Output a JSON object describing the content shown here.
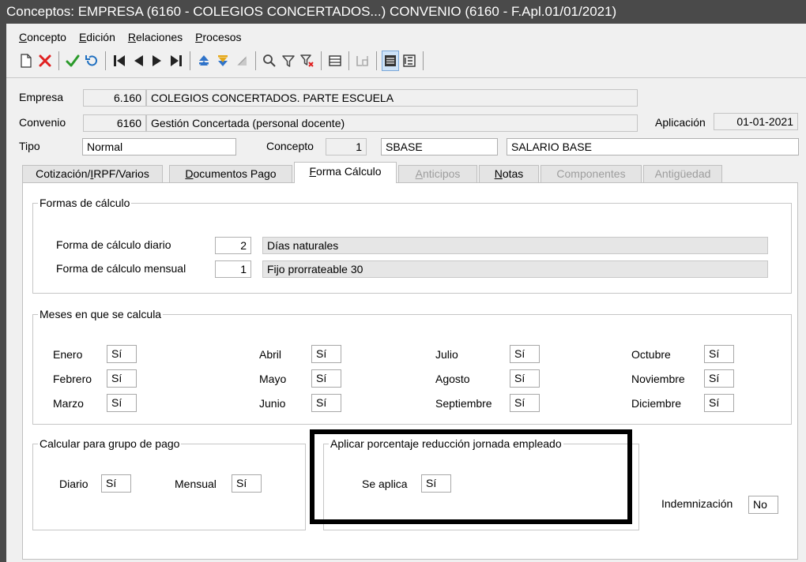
{
  "window": {
    "title": "Conceptos: EMPRESA (6160 - COLEGIOS CONCERTADOS...)  CONVENIO (6160 - F.Apl.01/01/2021)"
  },
  "menu": [
    {
      "key": "C",
      "rest": "oncepto"
    },
    {
      "key": "E",
      "rest": "dición"
    },
    {
      "key": "R",
      "rest": "elaciones"
    },
    {
      "key": "P",
      "rest": "rocesos"
    }
  ],
  "toolbar": {
    "new": "new-document-icon",
    "delete": "delete-x-icon",
    "confirm": "checkmark-icon",
    "undo": "undo-icon",
    "first": "first-record-icon",
    "prev": "previous-record-icon",
    "next": "next-record-icon",
    "last": "last-record-icon",
    "colors": {
      "delete": "#e02020",
      "confirm": "#2a9a2a",
      "undo": "#1e6fc0",
      "nav": "#222222",
      "sortUp": "#2f73c9",
      "sortDown": "#e6a817"
    }
  },
  "header": {
    "empresa_label": "Empresa",
    "empresa_code": "6.160",
    "empresa_name": "COLEGIOS CONCERTADOS. PARTE ESCUELA",
    "convenio_label": "Convenio",
    "convenio_code": "6160",
    "convenio_name": "Gestión Concertada (personal docente)",
    "aplicacion_label": "Aplicación",
    "aplicacion_value": "01-01-2021",
    "tipo_label": "Tipo",
    "tipo_value": "Normal",
    "concepto_label": "Concepto",
    "concepto_num": "1",
    "concepto_code": "SBASE",
    "concepto_desc": "SALARIO BASE"
  },
  "tabs": [
    {
      "pre": "Cotización/",
      "key": "I",
      "post": "RPF/Varios",
      "state": "normal"
    },
    {
      "pre": "",
      "key": "D",
      "post": "ocumentos Pago",
      "state": "normal"
    },
    {
      "pre": "",
      "key": "F",
      "post": "orma Cálculo",
      "state": "active"
    },
    {
      "pre": "",
      "key": "A",
      "post": "nticipos",
      "state": "disabled"
    },
    {
      "pre": "",
      "key": "N",
      "post": "otas",
      "state": "normal"
    },
    {
      "pre": "",
      "key": "",
      "post": "Componentes",
      "state": "disabled"
    },
    {
      "pre": "",
      "key": "",
      "post": "Antigüedad",
      "state": "disabled"
    }
  ],
  "formas": {
    "title": "Formas de cálculo",
    "diario_label": "Forma de cálculo diario",
    "diario_value": "2",
    "diario_desc": "Días naturales",
    "mensual_label": "Forma de cálculo mensual",
    "mensual_value": "1",
    "mensual_desc": "Fijo prorrateable 30"
  },
  "meses": {
    "title": "Meses en que se calcula",
    "items": [
      {
        "label": "Enero",
        "value": "Sí"
      },
      {
        "label": "Febrero",
        "value": "Sí"
      },
      {
        "label": "Marzo",
        "value": "Sí"
      },
      {
        "label": "Abril",
        "value": "Sí"
      },
      {
        "label": "Mayo",
        "value": "Sí"
      },
      {
        "label": "Junio",
        "value": "Sí"
      },
      {
        "label": "Julio",
        "value": "Sí"
      },
      {
        "label": "Agosto",
        "value": "Sí"
      },
      {
        "label": "Septiembre",
        "value": "Sí"
      },
      {
        "label": "Octubre",
        "value": "Sí"
      },
      {
        "label": "Noviembre",
        "value": "Sí"
      },
      {
        "label": "Diciembre",
        "value": "Sí"
      }
    ]
  },
  "grupo_pago": {
    "title": "Calcular para grupo de pago",
    "diario_label": "Diario",
    "diario_value": "Sí",
    "mensual_label": "Mensual",
    "mensual_value": "Sí"
  },
  "reduccion": {
    "title": "Aplicar porcentaje reducción jornada empleado",
    "label": "Se aplica",
    "value": "Sí"
  },
  "indemnizacion": {
    "label": "Indemnización",
    "value": "No"
  }
}
